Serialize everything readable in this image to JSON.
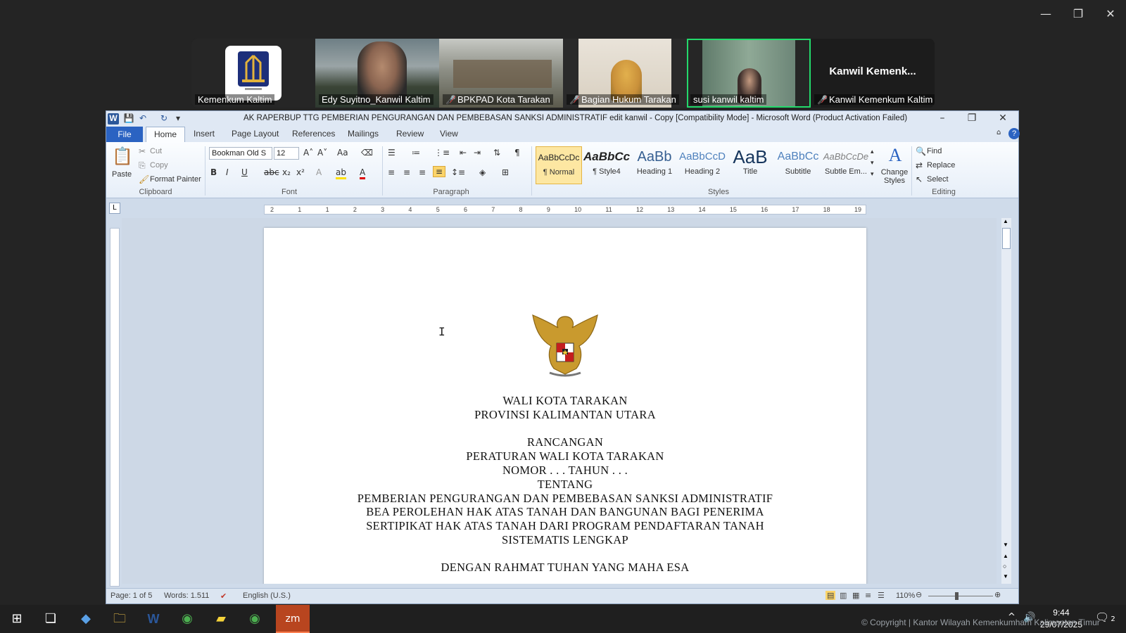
{
  "zoom_window": {
    "controls": [
      "—",
      "❐",
      "✕"
    ]
  },
  "participants": [
    {
      "name": "Kemenkum Kaltim",
      "muted": false,
      "active": false,
      "kind": "logo"
    },
    {
      "name": "Edy Suyitno_Kanwil Kaltim",
      "muted": false,
      "active": false,
      "kind": "video"
    },
    {
      "name": "BPKPAD Kota Tarakan",
      "muted": true,
      "active": false,
      "kind": "video"
    },
    {
      "name": "Bagian Hukum Tarakan",
      "muted": true,
      "active": false,
      "kind": "video"
    },
    {
      "name": "susi kanwil kaltim",
      "muted": false,
      "active": true,
      "kind": "video"
    },
    {
      "name": "Kanwil Kemenkum Kaltim",
      "muted": true,
      "active": false,
      "kind": "text",
      "display": "Kanwil  Kemenk..."
    }
  ],
  "word": {
    "title": "AK RAPERBUP TTG PEMBERIAN PENGURANGAN DAN PEMBEBASAN SANKSI ADMINISTRATIF edit kanwil - Copy [Compatibility Mode]  -  Microsoft Word (Product Activation Failed)",
    "tabs": [
      "File",
      "Home",
      "Insert",
      "Page Layout",
      "References",
      "Mailings",
      "Review",
      "View"
    ],
    "clipboard": {
      "paste": "Paste",
      "cut": "Cut",
      "copy": "Copy",
      "format_painter": "Format Painter",
      "label": "Clipboard"
    },
    "font": {
      "family": "Bookman Old S",
      "size": "12",
      "label": "Font"
    },
    "paragraph": {
      "label": "Paragraph"
    },
    "styles": {
      "label": "Styles",
      "items": [
        {
          "sample": "AaBbCcDc",
          "name": "¶ Normal",
          "selected": true
        },
        {
          "sample": "AaBbCc",
          "name": "¶ Style4",
          "selected": false
        },
        {
          "sample": "AaBb",
          "name": "Heading 1",
          "selected": false
        },
        {
          "sample": "AaBbCcD",
          "name": "Heading 2",
          "selected": false
        },
        {
          "sample": "AaB",
          "name": "Title",
          "selected": false
        },
        {
          "sample": "AaBbCc",
          "name": "Subtitle",
          "selected": false
        },
        {
          "sample": "AaBbCcDe",
          "name": "Subtle Em...",
          "selected": false
        }
      ],
      "change_styles": "Change Styles"
    },
    "editing": {
      "find": "Find",
      "replace": "Replace",
      "select": "Select",
      "label": "Editing"
    },
    "ruler_numbers": [
      "2",
      "1",
      "1",
      "2",
      "3",
      "4",
      "5",
      "6",
      "7",
      "8",
      "9",
      "10",
      "11",
      "12",
      "13",
      "14",
      "15",
      "16",
      "17",
      "18",
      "19"
    ],
    "document_lines": [
      "WALI KOTA TARAKAN",
      "PROVINSI KALIMANTAN UTARA",
      "",
      "RANCANGAN",
      "PERATURAN WALI KOTA TARAKAN",
      "NOMOR . . . TAHUN . . .",
      "TENTANG",
      "PEMBERIAN PENGURANGAN DAN PEMBEBASAN SANKSI ADMINISTRATIF",
      "BEA PEROLEHAN HAK ATAS TANAH DAN BANGUNAN BAGI PENERIMA",
      "SERTIPIKAT HAK ATAS TANAH DARI PROGRAM PENDAFTARAN TANAH",
      "SISTEMATIS LENGKAP",
      "",
      "DENGAN RAHMAT TUHAN YANG MAHA ESA"
    ],
    "status": {
      "page": "Page: 1 of 5",
      "words": "Words: 1.511",
      "language": "English (U.S.)",
      "zoom": "110%"
    }
  },
  "taskbar": {
    "time": "9:44",
    "date": "29/07/2025",
    "copyright": "© Copyright | Kantor Wilayah Kemenkumham Kalimantan Timur",
    "notif": "2"
  }
}
